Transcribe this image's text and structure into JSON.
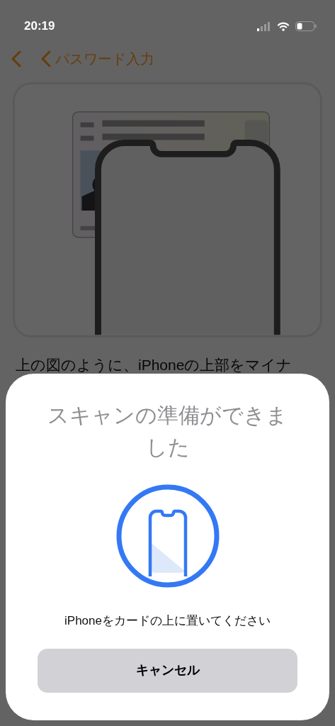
{
  "status_bar": {
    "time": "20:19"
  },
  "nav": {
    "back_buttons": [
      {
        "kind": "icon"
      },
      {
        "kind": "labeled",
        "label": "パスワード入力"
      }
    ]
  },
  "illustration": {
    "kind": "drawing"
  },
  "description": "上の図のように、iPhoneの上部をマイナ",
  "scan_sheet": {
    "title": "スキャンの準備ができました",
    "message": "iPhoneをカードの上に置いてください",
    "cancel_button": "キャンセル"
  }
}
